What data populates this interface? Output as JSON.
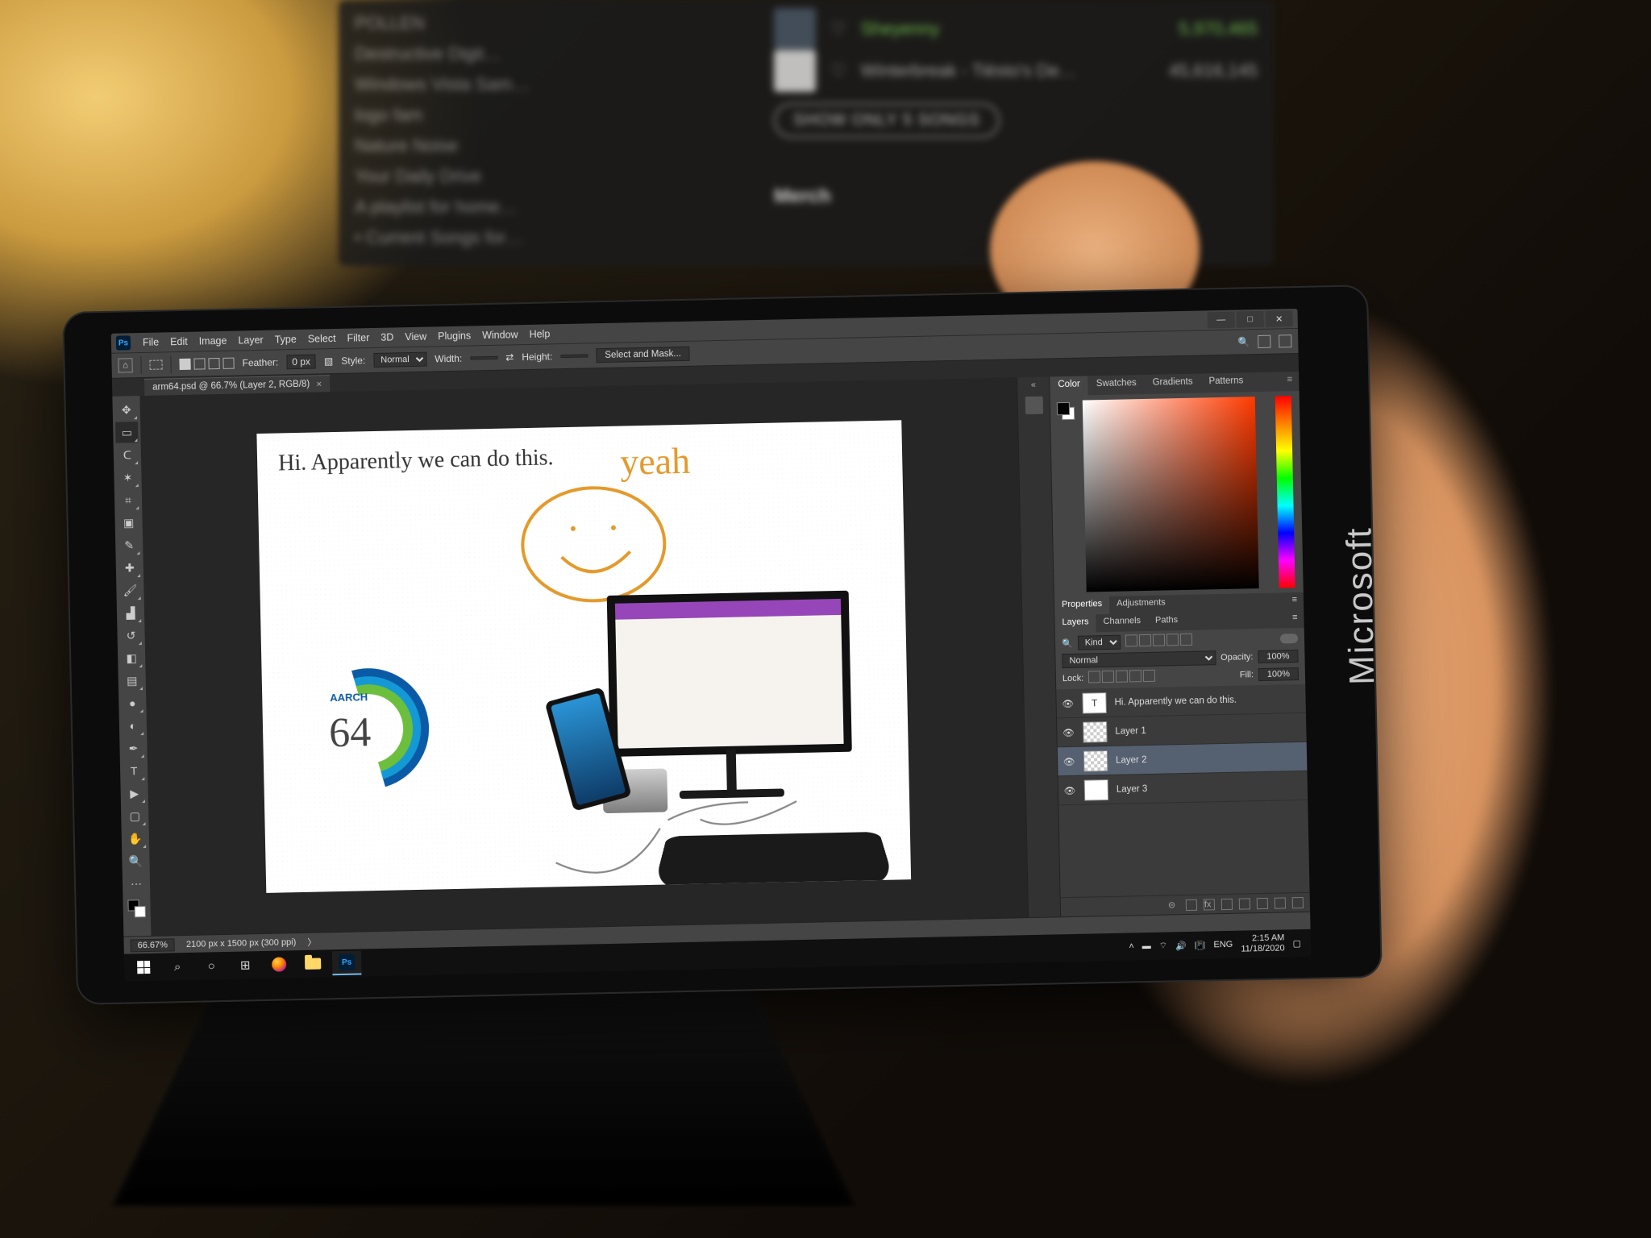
{
  "device_brand": "Microsoft",
  "bg": {
    "playlist": [
      "POLLEN",
      "Destructive Digit…",
      "Windows Vista Sam…",
      "logo fam",
      "Nature Noise",
      "Your Daily Drive",
      "A playlist for home…",
      "• Current Songs for…"
    ],
    "track1": {
      "title": "Sheyenny",
      "plays": "5,970,465"
    },
    "track2": {
      "title": "Winterbreak - Tiësto's De…",
      "plays": "45,616,145"
    },
    "button": "SHOW ONLY 5 SONGS",
    "section": "Merch"
  },
  "ps": {
    "menu": [
      "File",
      "Edit",
      "Image",
      "Layer",
      "Type",
      "Select",
      "Filter",
      "3D",
      "View",
      "Plugins",
      "Window",
      "Help"
    ],
    "options": {
      "feather_label": "Feather:",
      "feather_value": "0 px",
      "style_label": "Style:",
      "style_value": "Normal",
      "width_label": "Width:",
      "height_label": "Height:",
      "mask_button": "Select and Mask..."
    },
    "doc_tab": "arm64.psd @ 66.7% (Layer 2, RGB/8)",
    "canvas": {
      "headline": "Hi. Apparently we can do this.",
      "handwriting": "yeah",
      "logo_top": "AARCH",
      "logo_num": "64"
    },
    "status": {
      "zoom": "66.67%",
      "dims": "2100 px x 1500 px (300 ppi)"
    },
    "rightpanels": {
      "color_tabs": [
        "Color",
        "Swatches",
        "Gradients",
        "Patterns"
      ],
      "prop_tabs": [
        "Properties",
        "Adjustments"
      ],
      "layer_tabs": [
        "Layers",
        "Channels",
        "Paths"
      ],
      "filter_label": "Kind",
      "blend_mode": "Normal",
      "opacity_label": "Opacity:",
      "opacity_value": "100%",
      "lock_label": "Lock:",
      "fill_label": "Fill:",
      "fill_value": "100%",
      "layers": [
        {
          "name": "Hi. Apparently we can do this.",
          "type": "T"
        },
        {
          "name": "Layer 1",
          "type": "checker"
        },
        {
          "name": "Layer 2",
          "type": "checker",
          "selected": true
        },
        {
          "name": "Layer 3",
          "type": "img"
        }
      ]
    }
  },
  "taskbar": {
    "lang": "ENG",
    "time": "2:15 AM",
    "date": "11/18/2020"
  }
}
